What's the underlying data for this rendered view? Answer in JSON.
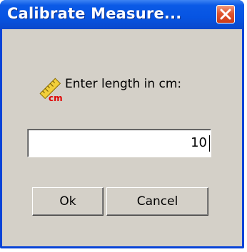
{
  "dialog": {
    "title": "Calibrate Measure...",
    "icon": "ruler-cm-icon",
    "prompt": "Enter length in cm:",
    "icon_label": "cm",
    "length_input": {
      "value": "10"
    },
    "ok_label": "Ok",
    "cancel_label": "Cancel"
  },
  "colors": {
    "titlebar": "#0654e2",
    "face": "#d4d0c8",
    "close": "#e0552f",
    "icon_text": "#e00000"
  }
}
